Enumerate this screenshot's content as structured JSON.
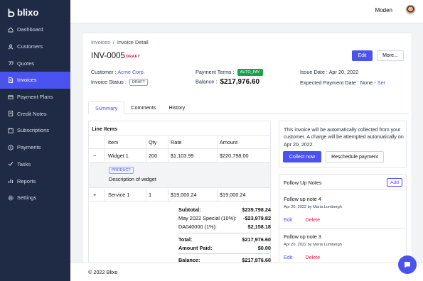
{
  "brand": {
    "name": "blixo"
  },
  "sidebar": {
    "items": [
      {
        "label": "Dashboard",
        "icon": "home-icon",
        "active": false
      },
      {
        "label": "Customers",
        "icon": "user-icon",
        "active": false
      },
      {
        "label": "Quotes",
        "icon": "quote-icon",
        "active": false
      },
      {
        "label": "Invoices",
        "icon": "invoice-icon",
        "active": true
      },
      {
        "label": "Payment Plans",
        "icon": "payment-plans-icon",
        "active": false
      },
      {
        "label": "Credit Notes",
        "icon": "credit-note-icon",
        "active": false
      },
      {
        "label": "Subscriptions",
        "icon": "subscription-icon",
        "active": false
      },
      {
        "label": "Payments",
        "icon": "payments-icon",
        "active": false
      },
      {
        "label": "Tasks",
        "icon": "tasks-icon",
        "active": false
      },
      {
        "label": "Reports",
        "icon": "reports-icon",
        "active": false
      },
      {
        "label": "Settings",
        "icon": "settings-icon",
        "active": false
      }
    ]
  },
  "header": {
    "user_name": "Moden"
  },
  "breadcrumb": {
    "parent": "Invoices",
    "separator": "/",
    "current": "Invoice Detail"
  },
  "invoice": {
    "number": "INV-0005",
    "status_badge": "DRAFT",
    "edit_label": "Edit",
    "more_label": "More...",
    "customer_label": "Customer :",
    "customer_value": "Acme Corp.",
    "status_label": "Invoice Status :",
    "status_value": "DRAFT",
    "terms_label": "Payment Terms :",
    "terms_value": "AUTO_PAY",
    "balance_label": "Balance :",
    "balance_value": "$217,976.60",
    "issue_label": "Issue Date :",
    "issue_value": "Apr 20, 2022",
    "expected_label": "Expected Payment Date :",
    "expected_value": "None -",
    "set_label": "Set"
  },
  "tabs": [
    "Summary",
    "Comments",
    "History"
  ],
  "line_items": {
    "title": "Line Items",
    "columns": [
      "Item",
      "Qty",
      "Rate",
      "Amount"
    ],
    "rows": [
      {
        "toggle": "−",
        "item": "Widget 1",
        "qty": "200",
        "rate": "$1,103.99",
        "amount": "$220,798.00"
      },
      {
        "toggle": "+",
        "item": "Service 1",
        "qty": "1",
        "rate": "$19,000.24",
        "amount": "$19,000.24"
      }
    ],
    "detail": {
      "tag": "PRODUCT",
      "description": "Description of widget"
    }
  },
  "totals": {
    "subtotal_label": "Subtotal:",
    "subtotal_value": "$239,798.24",
    "discount_label": "May 2022 Special (10%):",
    "discount_value": "-$23,979.82",
    "tax_label": "DA040000 (1%):",
    "tax_value": "$2,158.18",
    "total_label": "Total:",
    "total_value": "$217,976.60",
    "paid_label": "Amount Paid:",
    "paid_value": "$0.00",
    "balance_label": "Balance:",
    "balance_value": "$217,976.60"
  },
  "auto_collect": {
    "message": "This invoice will be automatically collected from your customer. A charge will be attempted automatically on Apr 20, 2022.",
    "collect_label": "Collect now",
    "reschedule_label": "Reschedule payment"
  },
  "follow_up": {
    "title": "Follow Up Notes",
    "add_label": "Add",
    "notes": [
      {
        "title": "Follow up note 4",
        "date": "Apr 20, 2022",
        "by": "by",
        "author": "Maria Lumbergh",
        "edit": "Edit",
        "delete": "Delete"
      },
      {
        "title": "Follow up note 3",
        "date": "Apr 20, 2022",
        "by": "by",
        "author": "Maria Lumbergh",
        "edit": "Edit",
        "delete": "Delete"
      }
    ]
  },
  "footer": {
    "copyright": "© 2022 Blixo"
  },
  "colors": {
    "sidebar": "#1f2a44",
    "accent": "#4a52f0",
    "danger": "#e11d48",
    "success": "#16a34a"
  }
}
